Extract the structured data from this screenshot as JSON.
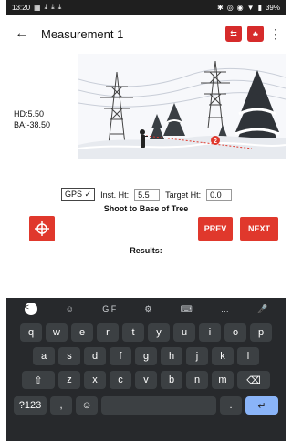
{
  "statusbar": {
    "time": "13:20",
    "left_icons": [
      "app-icon",
      "download-icon",
      "download-icon",
      "download-icon"
    ],
    "right_icons": [
      "bluetooth-icon",
      "location-icon",
      "vpn-icon",
      "wifi-icon",
      "battery-icon"
    ],
    "battery": "39%"
  },
  "appbar": {
    "title": "Measurement 1",
    "actions": [
      {
        "name": "export-icon",
        "color": "#d62b2b"
      },
      {
        "name": "tree-icon",
        "color": "#d62b2b"
      }
    ]
  },
  "readout": {
    "hd": "HD:5.50",
    "ba": "BA:-38.50"
  },
  "scene": {
    "marker": "2"
  },
  "controls": {
    "gps_label": "GPS ✓",
    "inst_ht_label": "Inst. Ht:",
    "inst_ht_value": "5.5",
    "target_ht_label": "Target Ht:",
    "target_ht_value": "0.0",
    "instruction": "Shoot to Base of Tree",
    "prev": "PREV",
    "next": "NEXT",
    "results": "Results:"
  },
  "keyboard": {
    "top": [
      "<",
      "☺",
      "GIF",
      "⚙",
      "⌨",
      "…",
      "🎤"
    ],
    "row1": [
      "q",
      "w",
      "e",
      "r",
      "t",
      "y",
      "u",
      "i",
      "o",
      "p"
    ],
    "row2": [
      "a",
      "s",
      "d",
      "f",
      "g",
      "h",
      "j",
      "k",
      "l"
    ],
    "row3": [
      "⇧",
      "z",
      "x",
      "c",
      "v",
      "b",
      "n",
      "m",
      "⌫"
    ],
    "row4": [
      "?123",
      ",",
      "☺",
      "",
      ".",
      "↵"
    ]
  }
}
